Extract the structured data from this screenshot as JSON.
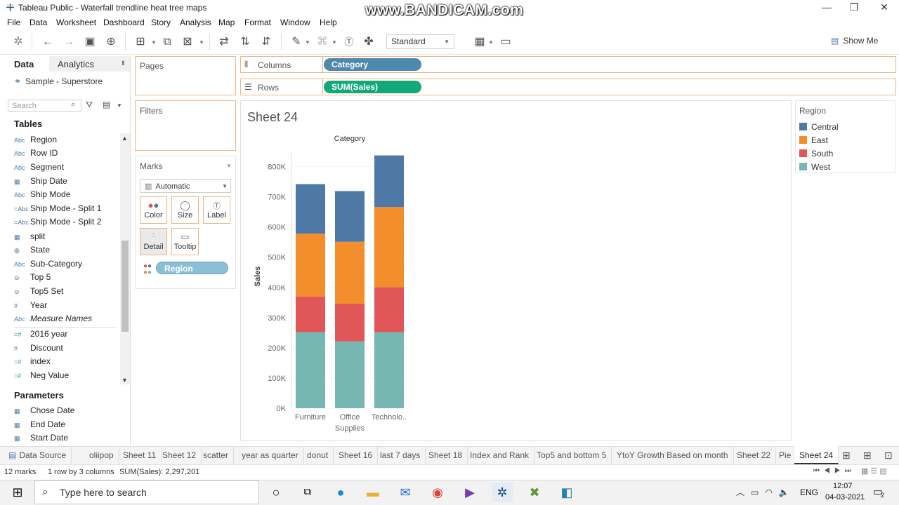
{
  "window": {
    "title": "Tableau Public - Waterfall trendline heat tree maps",
    "watermark": "www.BANDICAM.com",
    "minimize": "—",
    "maximize": "❐",
    "close": "✕"
  },
  "menu": [
    "File",
    "Data",
    "Worksheet",
    "Dashboard",
    "Story",
    "Analysis",
    "Map",
    "Format",
    "Window",
    "Help"
  ],
  "toolbar": {
    "fit": "Standard",
    "show_me": "Show Me"
  },
  "datapane": {
    "tab_data": "Data",
    "tab_analytics": "Analytics",
    "datasource": "Sample - Superstore",
    "search_placeholder": "Search",
    "tables_header": "Tables",
    "fields": [
      {
        "icon": "Abc",
        "name": "Region"
      },
      {
        "icon": "Abc",
        "name": "Row ID"
      },
      {
        "icon": "Abc",
        "name": "Segment"
      },
      {
        "icon": "cal",
        "name": "Ship Date"
      },
      {
        "icon": "Abc",
        "name": "Ship Mode"
      },
      {
        "icon": "=Abc",
        "name": "Ship Mode - Split 1"
      },
      {
        "icon": "=Abc",
        "name": "Ship Mode - Split 2"
      },
      {
        "icon": "cal",
        "name": "split"
      },
      {
        "icon": "geo",
        "name": "State"
      },
      {
        "icon": "Abc",
        "name": "Sub-Category"
      },
      {
        "icon": "set",
        "name": "Top 5"
      },
      {
        "icon": "set",
        "name": "Top5 Set"
      },
      {
        "icon": "#",
        "name": "Year"
      },
      {
        "icon": "Abc",
        "name": "Measure Names"
      },
      {
        "icon": "=#",
        "name": "2016 year"
      },
      {
        "icon": "#",
        "name": "Discount"
      },
      {
        "icon": "=#",
        "name": "index"
      },
      {
        "icon": "=#",
        "name": "Neg Value"
      }
    ],
    "parameters_header": "Parameters",
    "parameters": [
      "Chose Date",
      "End Date",
      "Start Date"
    ]
  },
  "shelves": {
    "pages": "Pages",
    "filters": "Filters",
    "columns_label": "Columns",
    "columns_pill": "Category",
    "rows_label": "Rows",
    "rows_pill": "SUM(Sales)"
  },
  "marks": {
    "title": "Marks",
    "type": "Automatic",
    "buttons": [
      "Color",
      "Size",
      "Label",
      "Detail",
      "Tooltip"
    ],
    "pill": "Region"
  },
  "sheet": {
    "title": "Sheet 24"
  },
  "legend": {
    "title": "Region",
    "items": [
      {
        "name": "Central",
        "color": "#4e79a7"
      },
      {
        "name": "East",
        "color": "#f28e2b"
      },
      {
        "name": "South",
        "color": "#e15759"
      },
      {
        "name": "West",
        "color": "#76b7b2"
      }
    ]
  },
  "chart_data": {
    "type": "bar",
    "stacked": true,
    "title": "Category",
    "xlabel": "",
    "ylabel": "Sales",
    "ylim": [
      0,
      850000
    ],
    "yticks": [
      "0K",
      "100K",
      "200K",
      "300K",
      "400K",
      "500K",
      "600K",
      "700K",
      "800K"
    ],
    "categories": [
      "Furniture",
      "Office Supplies",
      "Technolo.."
    ],
    "series": [
      {
        "name": "West",
        "color": "#76b7b2",
        "values": [
          252000,
          221000,
          252000
        ]
      },
      {
        "name": "South",
        "color": "#e15759",
        "values": [
          118000,
          125000,
          149000
        ]
      },
      {
        "name": "East",
        "color": "#f28e2b",
        "values": [
          208000,
          205000,
          265000
        ]
      },
      {
        "name": "Central",
        "color": "#4e79a7",
        "values": [
          164000,
          168000,
          171000
        ]
      }
    ]
  },
  "sheet_tabs": [
    "Data Source",
    "oliipop",
    "Sheet 11",
    "Sheet 12",
    "scatter",
    "year as quarter",
    "donut",
    "Sheet 16",
    "last 7 days",
    "Sheet 18",
    "Index and Rank",
    "Top5 and bottom 5",
    "YtoY Growth Based on month",
    "Sheet 22",
    "Pie",
    "Sheet 24"
  ],
  "status": {
    "marks": "12 marks",
    "rows": "1 row by 3 columns",
    "sum": "SUM(Sales): 2,297,201"
  },
  "taskbar": {
    "search_placeholder": "Type here to search",
    "time": "12:07",
    "date": "04-03-2021",
    "lang": "ENG",
    "notif": "2"
  }
}
